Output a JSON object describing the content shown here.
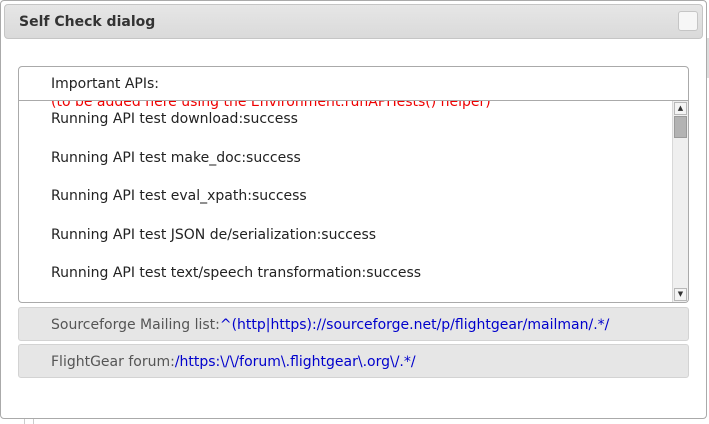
{
  "dialog": {
    "title": "Self Check dialog"
  },
  "api_panel": {
    "header": "Important APIs:",
    "cutoff_line": "(to be added here using the Environment.runAPITests() helper)",
    "log_lines": [
      "Running API test download:success",
      "Running API test make_doc:success",
      "Running API test eval_xpath:success",
      "Running API test JSON de/serialization:success",
      "Running API test text/speech transformation:success"
    ]
  },
  "links": {
    "mailing_list": {
      "label": "Sourceforge Mailing list:",
      "value": "^(http|https)://sourceforge.net/p/flightgear/mailman/.*/"
    },
    "forum": {
      "label": "FlightGear forum:",
      "value": "/https:\\/\\/forum\\.flightgear\\.org\\/.*/"
    }
  },
  "colors": {
    "error_text": "#ee0000",
    "link_text": "#0000cc"
  },
  "icons": {
    "close": "close-icon",
    "scroll_up": "arrow-up-icon",
    "scroll_down": "arrow-down-icon"
  }
}
